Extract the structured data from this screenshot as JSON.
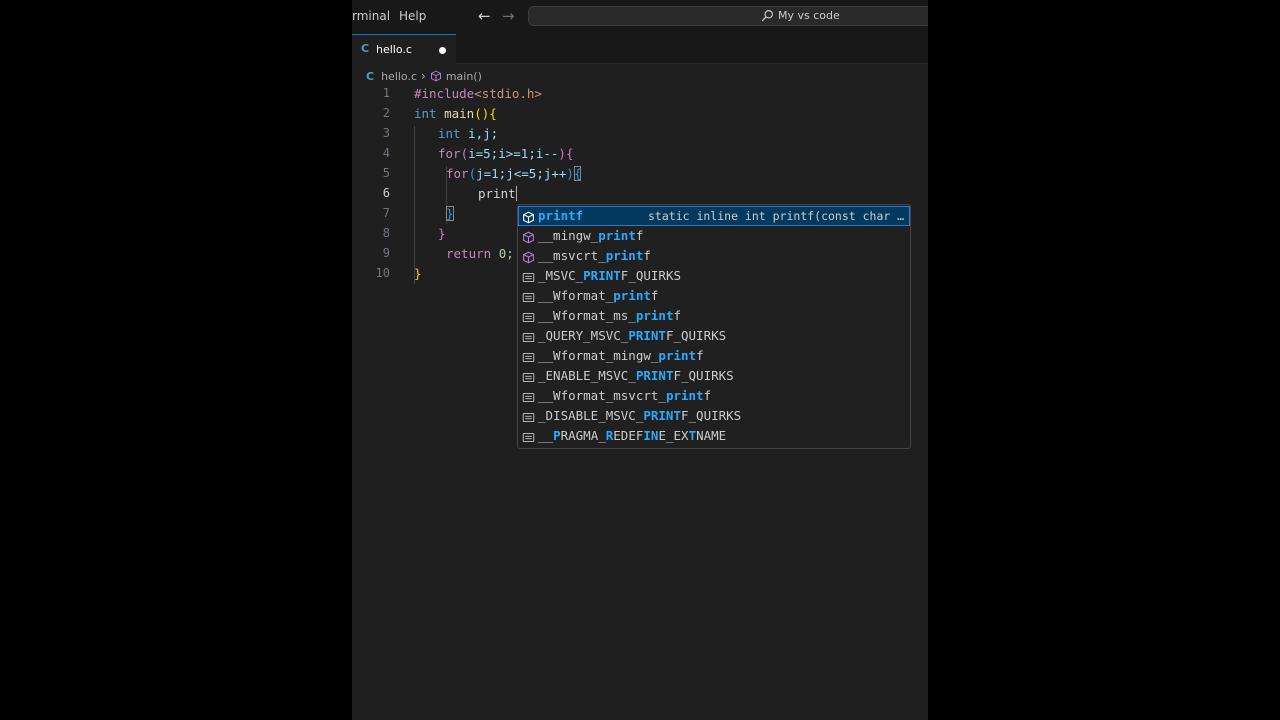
{
  "menu": {
    "terminal": "rminal",
    "help": "Help"
  },
  "nav": {
    "back": "←",
    "forward": "→"
  },
  "command_center": {
    "label": "My vs code",
    "icon": "search-icon"
  },
  "tab": {
    "icon_letter": "C",
    "filename": "hello.c",
    "modified": true
  },
  "breadcrumb": {
    "file": "hello.c",
    "separator": "›",
    "symbol": "main()"
  },
  "editor": {
    "active_line": 6,
    "line_numbers": [
      "1",
      "2",
      "3",
      "4",
      "5",
      "6",
      "7",
      "8",
      "9",
      "10"
    ],
    "tokens": {
      "include": "#include",
      "header": "<stdio.h>",
      "int": "int",
      "main": "main",
      "open_paren": "(",
      "close_paren": ")",
      "open_brace": "{",
      "close_brace": "}",
      "ij": "i,j;",
      "for": "for",
      "cond1": "i=5;i>=1;i--",
      "cond2": "j=1;j<=5;j++",
      "typed": "print",
      "return": "return",
      "zero": "0;"
    }
  },
  "suggestions": [
    {
      "kind": "method",
      "pre": "",
      "hl": "printf",
      "post": "",
      "detail": "static inline int printf(const char …",
      "selected": true
    },
    {
      "kind": "method",
      "pre": "__mingw_",
      "hl": "print",
      "post": "f"
    },
    {
      "kind": "method",
      "pre": "__msvcrt_",
      "hl": "print",
      "post": "f"
    },
    {
      "kind": "text",
      "pre": "_MSVC_",
      "hl": "PRINT",
      "post": "F_QUIRKS"
    },
    {
      "kind": "text",
      "pre": "__Wformat_",
      "hl": "print",
      "post": "f"
    },
    {
      "kind": "text",
      "pre": "__Wformat_ms_",
      "hl": "print",
      "post": "f"
    },
    {
      "kind": "text",
      "pre": "_QUERY_MSVC_",
      "hl": "PRINT",
      "post": "F_QUIRKS"
    },
    {
      "kind": "text",
      "pre": "__Wformat_mingw_",
      "hl": "print",
      "post": "f"
    },
    {
      "kind": "text",
      "pre": "_ENABLE_MSVC_",
      "hl": "PRINT",
      "post": "F_QUIRKS"
    },
    {
      "kind": "text",
      "pre": "__Wformat_msvcrt_",
      "hl": "print",
      "post": "f"
    },
    {
      "kind": "text",
      "pre": "_DISABLE_MSVC_",
      "hl": "PRINT",
      "post": "F_QUIRKS"
    },
    {
      "kind": "text",
      "pre": "__",
      "hl": "P",
      "post": "RAGMA_REDEFINE_EXTNAME",
      "parts": [
        [
          "__",
          ""
        ],
        [
          "P",
          "hl"
        ],
        [
          "RAGMA_",
          ""
        ],
        [
          "R",
          "hl"
        ],
        [
          "EDEF",
          ""
        ],
        [
          "IN",
          "hl"
        ],
        [
          "E_EX",
          ""
        ],
        [
          "T",
          "hl"
        ],
        [
          "NAME",
          ""
        ]
      ]
    }
  ],
  "colors": {
    "editor_bg": "#1f1f1f",
    "titlebar_bg": "#181818",
    "accent": "#0078d4",
    "match_highlight": "#2aaaff",
    "selected_bg": "#04395e",
    "method_icon": "#b180d7"
  }
}
